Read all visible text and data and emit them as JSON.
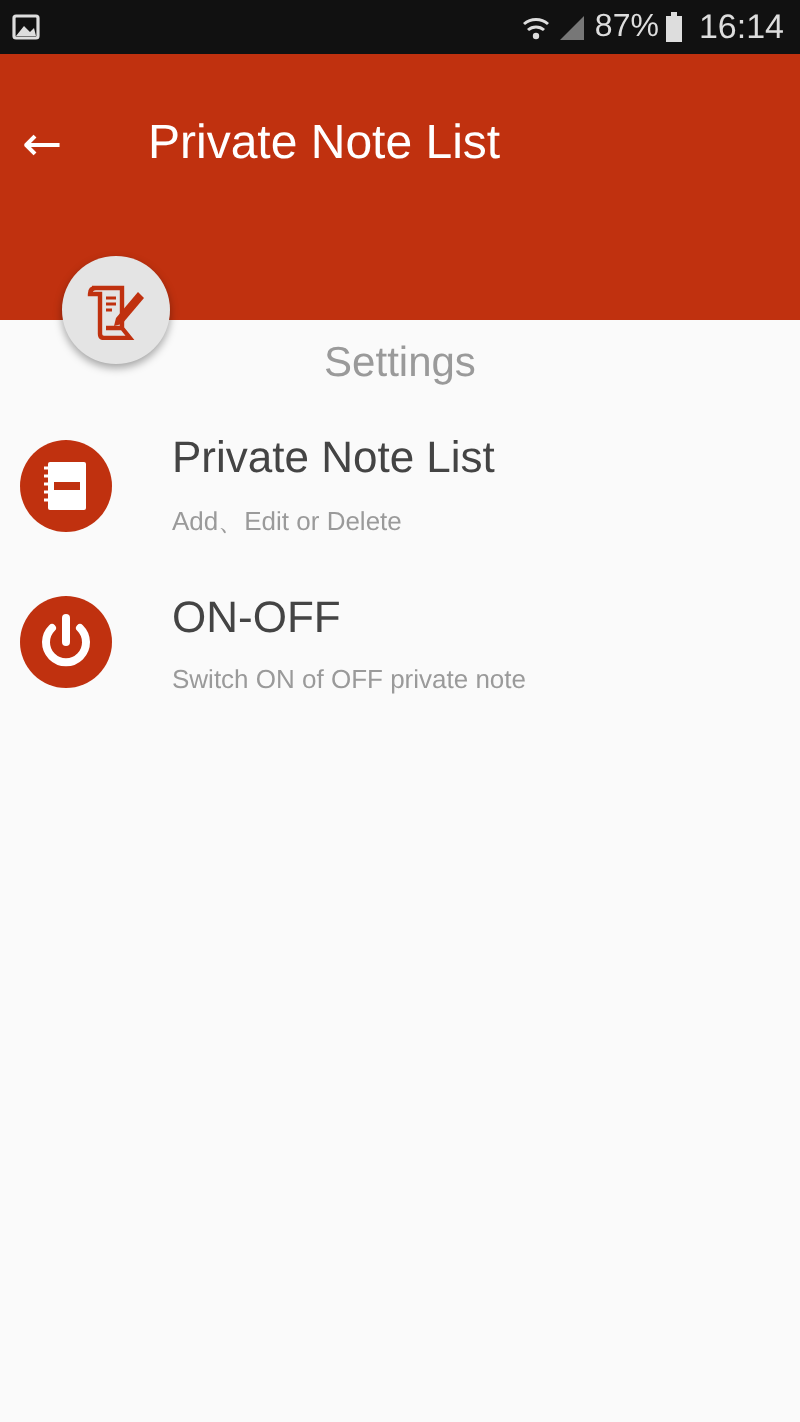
{
  "status_bar": {
    "battery": "87%",
    "time": "16:14"
  },
  "app_bar": {
    "back": "←",
    "title": "Private Note List"
  },
  "section_title": "Settings",
  "items": [
    {
      "kind": "notebook",
      "title": "Private Note List",
      "subtitle": "Add、Edit or Delete"
    },
    {
      "kind": "power",
      "title": "ON-OFF",
      "subtitle": "Switch ON of OFF private note"
    }
  ]
}
